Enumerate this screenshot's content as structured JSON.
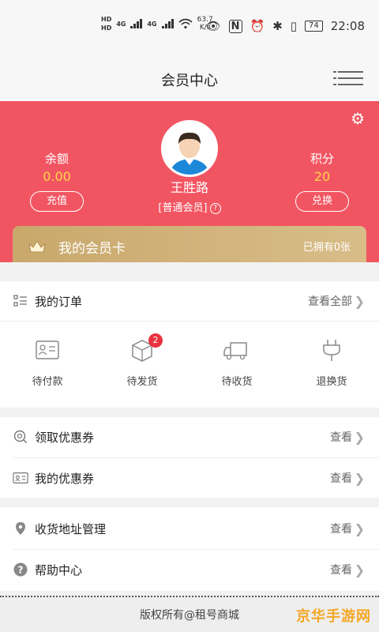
{
  "status_bar": {
    "hd1": "HD",
    "hd2": "HD",
    "net1": "4G",
    "net2": "4G",
    "speed_value": "63.7",
    "speed_unit": "K/s",
    "battery": "74",
    "time": "22:08"
  },
  "nav": {
    "title": "会员中心"
  },
  "profile": {
    "name": "王胜路",
    "level": "[普通会员]",
    "balance_label": "余额",
    "balance_value": "0.00",
    "recharge_label": "充值",
    "points_label": "积分",
    "points_value": "20",
    "redeem_label": "兑换"
  },
  "member_card": {
    "title": "我的会员卡",
    "count": "已拥有0张"
  },
  "orders": {
    "title": "我的订单",
    "view_all": "查看全部",
    "items": [
      {
        "label": "待付款",
        "icon": "card-icon"
      },
      {
        "label": "待发货",
        "icon": "box-icon",
        "badge": "2"
      },
      {
        "label": "待收货",
        "icon": "truck-icon"
      },
      {
        "label": "退换货",
        "icon": "plug-icon"
      }
    ]
  },
  "coupons": [
    {
      "label": "领取优惠券",
      "action": "查看"
    },
    {
      "label": "我的优惠券",
      "action": "查看"
    }
  ],
  "others": [
    {
      "label": "收货地址管理",
      "action": "查看"
    },
    {
      "label": "帮助中心",
      "action": "查看"
    }
  ],
  "footer": {
    "text": "版权所有@租号商城",
    "watermark": "京华手游网"
  },
  "colors": {
    "hero_bg": "#f25562",
    "value_yellow": "#ffd54a",
    "card_gold": "#c9a86c",
    "badge_red": "#e8333f"
  }
}
